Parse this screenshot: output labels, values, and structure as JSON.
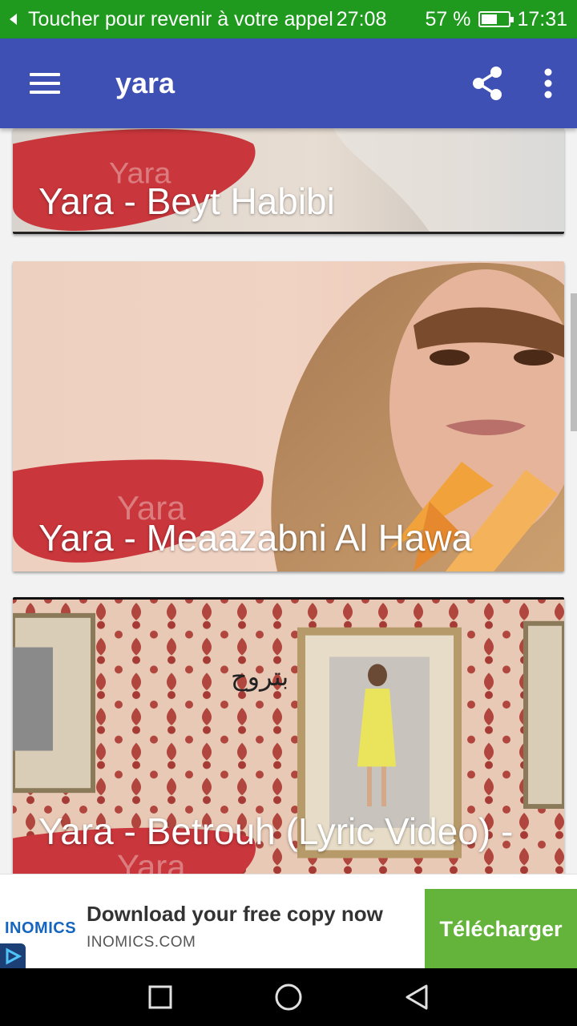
{
  "status_bar": {
    "call_text": "Toucher pour revenir à votre appel",
    "call_timer": "27:08",
    "battery_level": "57 %",
    "battery_fraction": 0.57,
    "time": "17:31"
  },
  "app_bar": {
    "title": "yara",
    "color": "#3e50b4"
  },
  "videos": [
    {
      "title": "Yara - Beyt Habibi"
    },
    {
      "title": "Yara - Meaazabni Al Hawa"
    },
    {
      "title": "Yara - Betrouh (Lyric Video) -"
    }
  ],
  "ad": {
    "logo_text": "INOMICS",
    "headline": "Download your free copy now",
    "domain": "INOMICS.COM",
    "cta_label": "Télécharger",
    "cta_color": "#64b43b"
  },
  "icons": [
    "menu-icon",
    "share-icon",
    "more-vert-icon",
    "ad-choices-icon",
    "recents-icon",
    "home-icon",
    "back-icon"
  ]
}
